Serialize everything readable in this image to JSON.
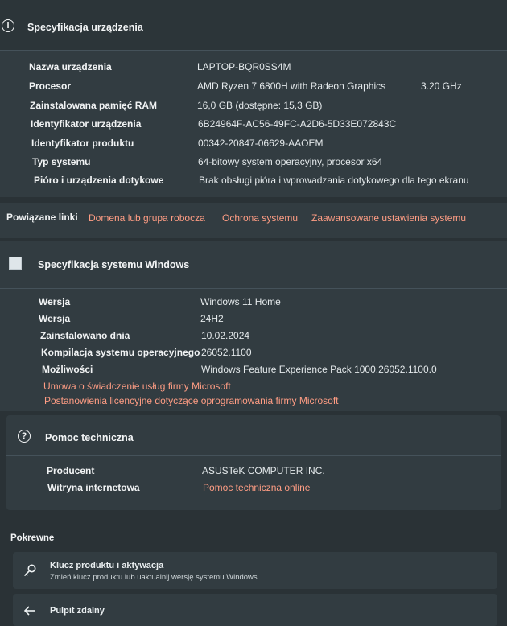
{
  "device": {
    "title": "Specyfikacja urządzenia",
    "rows": [
      {
        "label": "Nazwa urządzenia",
        "value": "LAPTOP-BQR0SS4M"
      },
      {
        "label": "Procesor",
        "value": "AMD Ryzen 7 6800H with Radeon Graphics",
        "extra": "3.20 GHz"
      },
      {
        "label": "Zainstalowana pamięć RAM",
        "value": "16,0 GB (dostępne: 15,3 GB)"
      },
      {
        "label": "Identyfikator urządzenia",
        "value": "6B24964F-AC56-49FC-A2D6-5D33E072843C"
      },
      {
        "label": "Identyfikator produktu",
        "value": "00342-20847-06629-AAOEM"
      },
      {
        "label": "Typ systemu",
        "value": "64-bitowy system operacyjny, procesor x64"
      },
      {
        "label": "Pióro i urządzenia dotykowe",
        "value": "Brak obsługi pióra i wprowadzania dotykowego dla tego ekranu"
      }
    ]
  },
  "related": {
    "label": "Powiązane linki",
    "links": [
      "Domena lub grupa robocza",
      "Ochrona systemu",
      "Zaawansowane ustawienia systemu"
    ]
  },
  "windows": {
    "title": "Specyfikacja systemu Windows",
    "rows": [
      {
        "label": "Wersja",
        "value": "Windows 11 Home"
      },
      {
        "label": "Wersja",
        "value": "24H2"
      },
      {
        "label": "Zainstalowano dnia",
        "value": "10.02.2024"
      },
      {
        "label": "Kompilacja systemu operacyjnego",
        "value": "26052.1100"
      },
      {
        "label": "Możliwości",
        "value": "Windows Feature Experience Pack 1000.26052.1100.0"
      }
    ],
    "links": [
      "Umowa o świadczenie usług firmy Microsoft",
      "Postanowienia licencyjne dotyczące oprogramowania firmy Microsoft"
    ]
  },
  "support": {
    "title": "Pomoc techniczna",
    "rows": [
      {
        "label": "Producent",
        "value": "ASUSTeK COMPUTER INC."
      },
      {
        "label": "Witryna internetowa",
        "value": "Pomoc techniczna online"
      }
    ]
  },
  "related2": {
    "header": "Pokrewne",
    "items": [
      {
        "title": "Klucz produktu i aktywacja",
        "subtitle": "Zmień klucz produktu lub uaktualnij wersję systemu Windows"
      },
      {
        "title": "Pulpit zdalny"
      }
    ]
  }
}
